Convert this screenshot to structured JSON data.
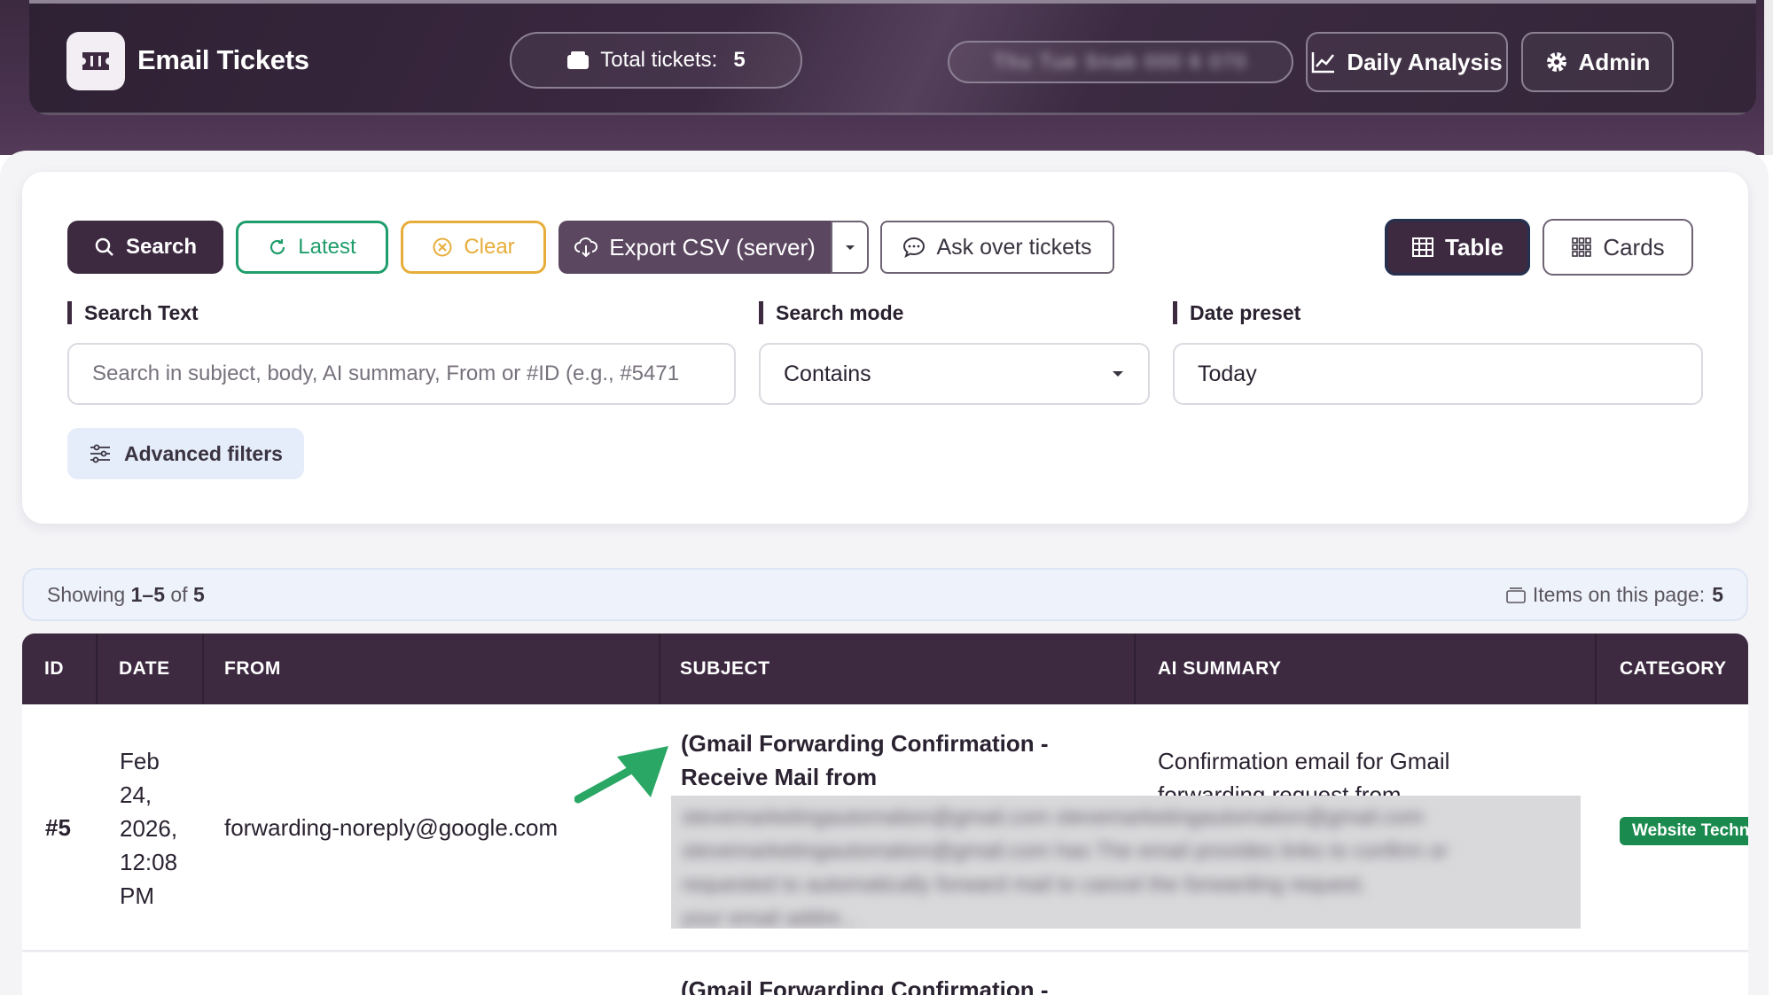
{
  "header": {
    "app_title": "Email Tickets",
    "total_label": "Total tickets:",
    "total_value": "5",
    "blurred_field": "Thu Tue Snab 000 6 070",
    "daily_analysis_label": "Daily Analysis",
    "admin_label": "Admin"
  },
  "toolbar": {
    "search_label": "Search",
    "latest_label": "Latest",
    "clear_label": "Clear",
    "export_label": "Export CSV (server)",
    "ask_label": "Ask over tickets",
    "table_label": "Table",
    "cards_label": "Cards"
  },
  "filters": {
    "search_text_label": "Search Text",
    "search_text_placeholder": "Search in subject, body, AI summary, From or #ID (e.g., #5471",
    "search_mode_label": "Search mode",
    "search_mode_value": "Contains",
    "date_preset_label": "Date preset",
    "date_preset_value": "Today",
    "advanced_label": "Advanced filters"
  },
  "summary": {
    "showing_prefix": "Showing",
    "range": "1–5",
    "of_word": "of",
    "total": "5",
    "items_label": "Items on this page:",
    "items_value": "5"
  },
  "table": {
    "columns": [
      "ID",
      "DATE",
      "FROM",
      "SUBJECT",
      "AI SUMMARY",
      "CATEGORY"
    ],
    "rows": [
      {
        "id": "#5",
        "date_lines": [
          "Feb",
          "24,",
          "2026,",
          "12:08",
          "PM"
        ],
        "from": "forwarding-noreply@google.com",
        "subject_lines": [
          "(Gmail Forwarding Confirmation -",
          "Receive Mail from"
        ],
        "summary_lines": [
          "Confirmation email for Gmail",
          "forwarding request from"
        ],
        "category": "Website Technical",
        "blurred_lines": [
          "stevemarketingautomation@gmail.com   stevemarketingautomation@gmail.com",
          "stevemarketingautomation@gmail.com has   The email provides links to confirm or",
          "requested to automatically forward mail to   cancel the forwarding request.",
          "your email addre..."
        ]
      },
      {
        "subject_lines": [
          "(Gmail Forwarding Confirmation -"
        ]
      }
    ]
  }
}
